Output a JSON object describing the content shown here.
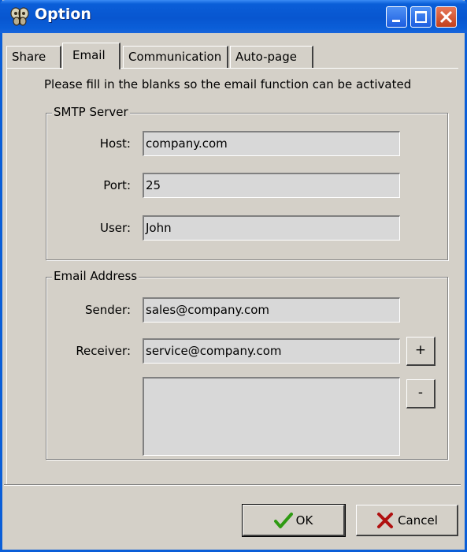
{
  "window": {
    "title": "Option"
  },
  "tabs": [
    {
      "label": "Share",
      "selected": false
    },
    {
      "label": "Email",
      "selected": true
    },
    {
      "label": "Communication",
      "selected": false
    },
    {
      "label": "Auto-page",
      "selected": false
    }
  ],
  "email_tab": {
    "instruction": "Please fill in the blanks so the email function can be activated",
    "smtp": {
      "legend": "SMTP Server",
      "host_label": "Host:",
      "host_value": "company.com",
      "port_label": "Port:",
      "port_value": "25",
      "user_label": "User:",
      "user_value": "John"
    },
    "address": {
      "legend": "Email Address",
      "sender_label": "Sender:",
      "sender_value": "sales@company.com",
      "receiver_label": "Receiver:",
      "receiver_value": "service@company.com",
      "add_label": "+",
      "remove_label": "-"
    }
  },
  "footer": {
    "ok_label": "OK",
    "cancel_label": "Cancel"
  },
  "icons": {
    "app": "butterfly-icon",
    "ok": "checkmark-icon",
    "cancel": "x-mark-icon"
  },
  "colors": {
    "titlebar": "#0a5ed8",
    "window_bg": "#d4d0c8",
    "close_button": "#c3401c",
    "ok_check": "#2e9a12",
    "cancel_x": "#b01010"
  }
}
